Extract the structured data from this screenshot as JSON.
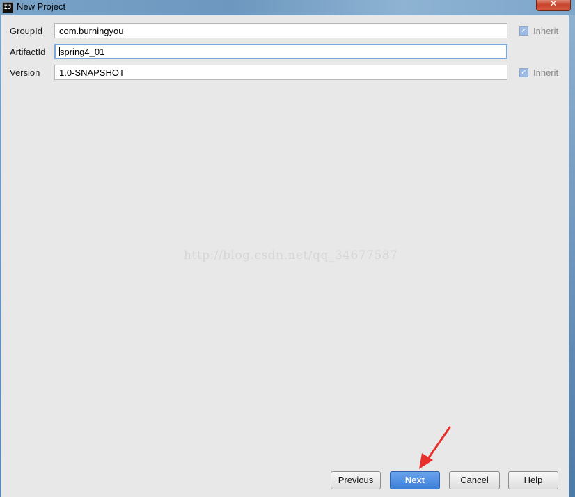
{
  "window": {
    "title": "New Project",
    "app_icon_text": "IJ",
    "close_glyph": "✕"
  },
  "form": {
    "group_id": {
      "label": "GroupId",
      "value": "com.burningyou",
      "inherit_label": "Inherit",
      "inherit_checked": true
    },
    "artifact_id": {
      "label": "ArtifactId",
      "value": "spring4_01"
    },
    "version": {
      "label": "Version",
      "value": "1.0-SNAPSHOT",
      "inherit_label": "Inherit",
      "inherit_checked": true
    }
  },
  "watermark": "http://blog.csdn.net/qq_34677587",
  "buttons": {
    "previous": {
      "mnemonic": "P",
      "rest": "revious"
    },
    "next": {
      "mnemonic": "N",
      "rest": "ext"
    },
    "cancel": "Cancel",
    "help": "Help"
  },
  "colors": {
    "primary_button": "#3d7fd9",
    "annotation_arrow": "#e8302a",
    "checkbox": "#9dbbe2"
  },
  "icons": {
    "checkbox_check": "✓"
  }
}
